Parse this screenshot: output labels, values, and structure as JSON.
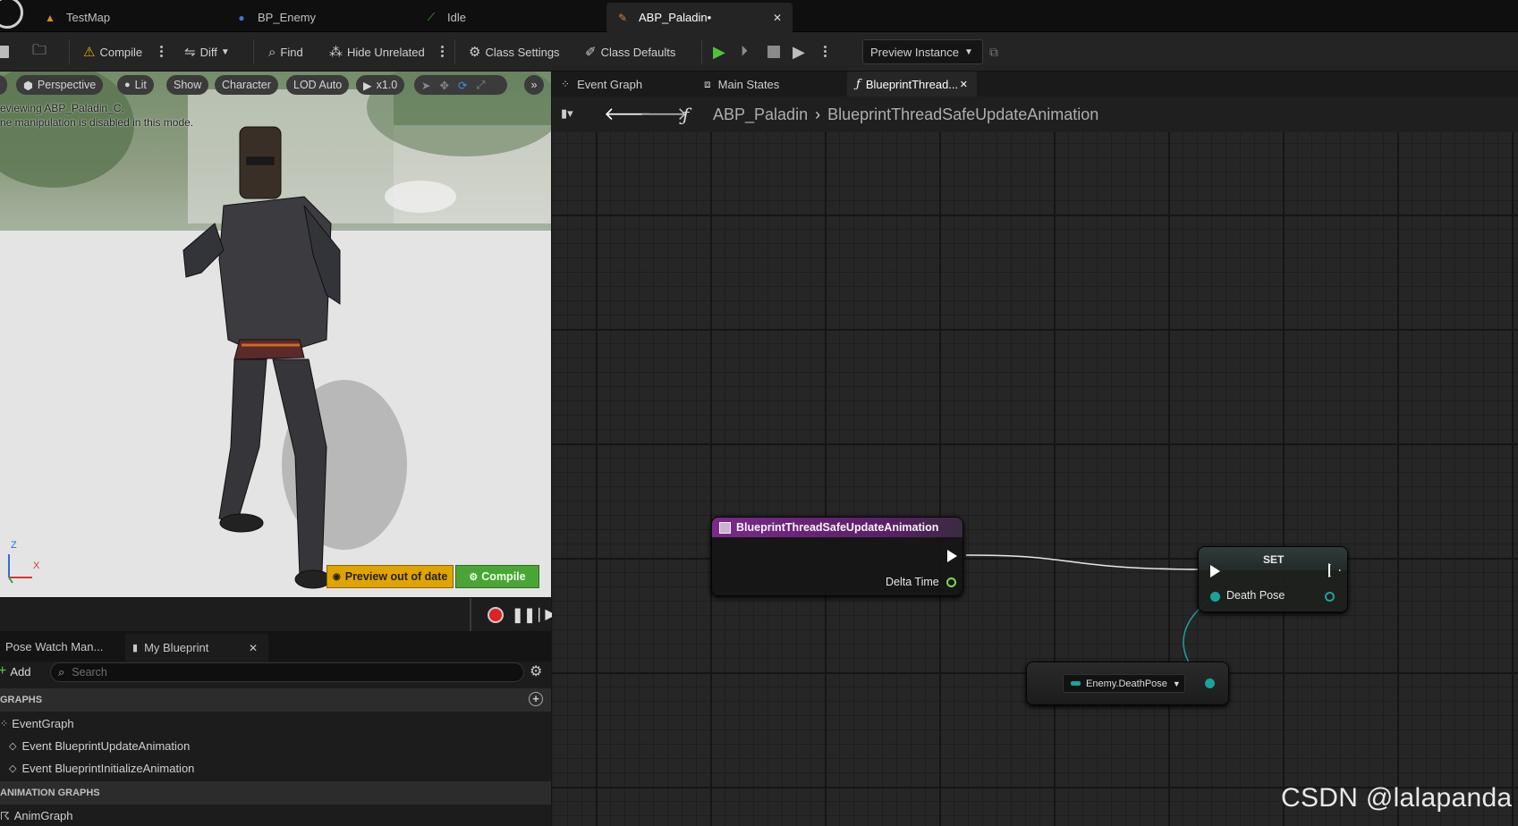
{
  "tabs": [
    {
      "label": "TestMap",
      "icon": "level-icon"
    },
    {
      "label": "BP_Enemy",
      "icon": "blueprint-pawn-icon"
    },
    {
      "label": "Idle",
      "icon": "animation-sequence-icon"
    },
    {
      "label": "ABP_Paladin•",
      "icon": "anim-blueprint-icon",
      "active": true
    }
  ],
  "toolbar": {
    "compile": "Compile",
    "diff": "Diff",
    "find": "Find",
    "hide_unrelated": "Hide Unrelated",
    "class_settings": "Class Settings",
    "class_defaults": "Class Defaults",
    "preview_instance": "Preview Instance"
  },
  "viewport": {
    "perspective": "Perspective",
    "lit": "Lit",
    "show": "Show",
    "character": "Character",
    "lod": "LOD Auto",
    "speed": "x1.0",
    "info_line1": "eviewing ABP_Paladin_C.",
    "info_line2": "ne manipulation is disabled in this mode.",
    "preview_out_of_date": "Preview out of date",
    "compile": "Compile",
    "axis_z": "Z",
    "axis_x": "X"
  },
  "panel": {
    "tab_pose_watch": "Pose Watch Man...",
    "tab_my_blueprint": "My Blueprint",
    "add": "Add",
    "search_placeholder": "Search",
    "graphs_header": "GRAPHS",
    "graph_items": [
      "EventGraph",
      "Event BlueprintUpdateAnimation",
      "Event BlueprintInitializeAnimation"
    ],
    "anim_graphs_header": "ANIMATION GRAPHS",
    "anim_graph_items": [
      "AnimGraph"
    ]
  },
  "graph": {
    "tabs": [
      "Event Graph",
      "Main States",
      "BlueprintThread..."
    ],
    "breadcrumb_root": "ABP_Paladin",
    "breadcrumb_leaf": "BlueprintThreadSafeUpdateAnimation",
    "entry_node_title": "BlueprintThreadSafeUpdateAnimation",
    "entry_pin": "Delta Time",
    "set_node_title": "SET",
    "set_pin": "Death Pose",
    "property_node_label": "Enemy.DeathPose"
  },
  "watermark": "CSDN @lalapanda",
  "colors": {
    "accent_green": "#4aa536",
    "warning": "#e0a400",
    "function_header": "#7a2a8a",
    "pose_pin": "#1aa39a"
  }
}
